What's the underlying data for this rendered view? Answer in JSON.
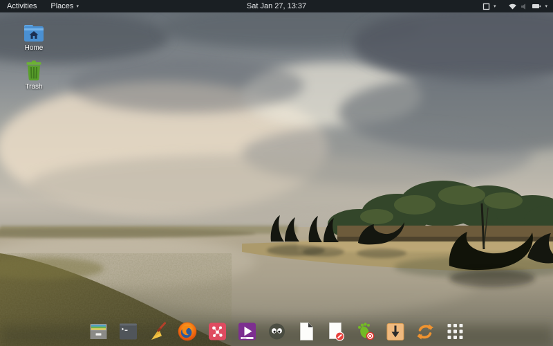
{
  "top_bar": {
    "activities_label": "Activities",
    "places_label": "Places",
    "places_caret": "▾",
    "clock": "Sat Jan 27, 13:37",
    "right_caret": "▾",
    "right_icons": [
      "window-indicator-icon",
      "wifi-icon",
      "volume-icon",
      "battery-icon"
    ],
    "background_color": "#1a1f23"
  },
  "desktop": {
    "icons": [
      {
        "name": "home-folder-icon",
        "label": "Home"
      },
      {
        "name": "trash-icon",
        "label": "Trash"
      }
    ]
  },
  "dock": {
    "items": [
      {
        "name": "file-manager-icon"
      },
      {
        "name": "terminal-icon"
      },
      {
        "name": "broom-cleaner-icon"
      },
      {
        "name": "firefox-icon"
      },
      {
        "name": "red-molecule-app-icon"
      },
      {
        "name": "video-player-icon"
      },
      {
        "name": "googly-eyes-app-icon"
      },
      {
        "name": "document-app-icon"
      },
      {
        "name": "document-blocked-app-icon"
      },
      {
        "name": "gnome-foot-recorder-icon"
      },
      {
        "name": "download-manager-icon"
      },
      {
        "name": "sync-updater-icon"
      },
      {
        "name": "app-grid-icon"
      }
    ]
  },
  "colors": {
    "topbar_bg": "#1a1f23",
    "topbar_text": "#e8eaec",
    "folder_blue": "#4a90d2",
    "trash_green": "#5aa02c",
    "firefox_orange": "#f0670e",
    "video_purple": "#7d2f90",
    "molecule_red": "#df4b60",
    "download_tan": "#efb97e",
    "sync_orange": "#ef9330",
    "gnome_green": "#73ba25"
  }
}
